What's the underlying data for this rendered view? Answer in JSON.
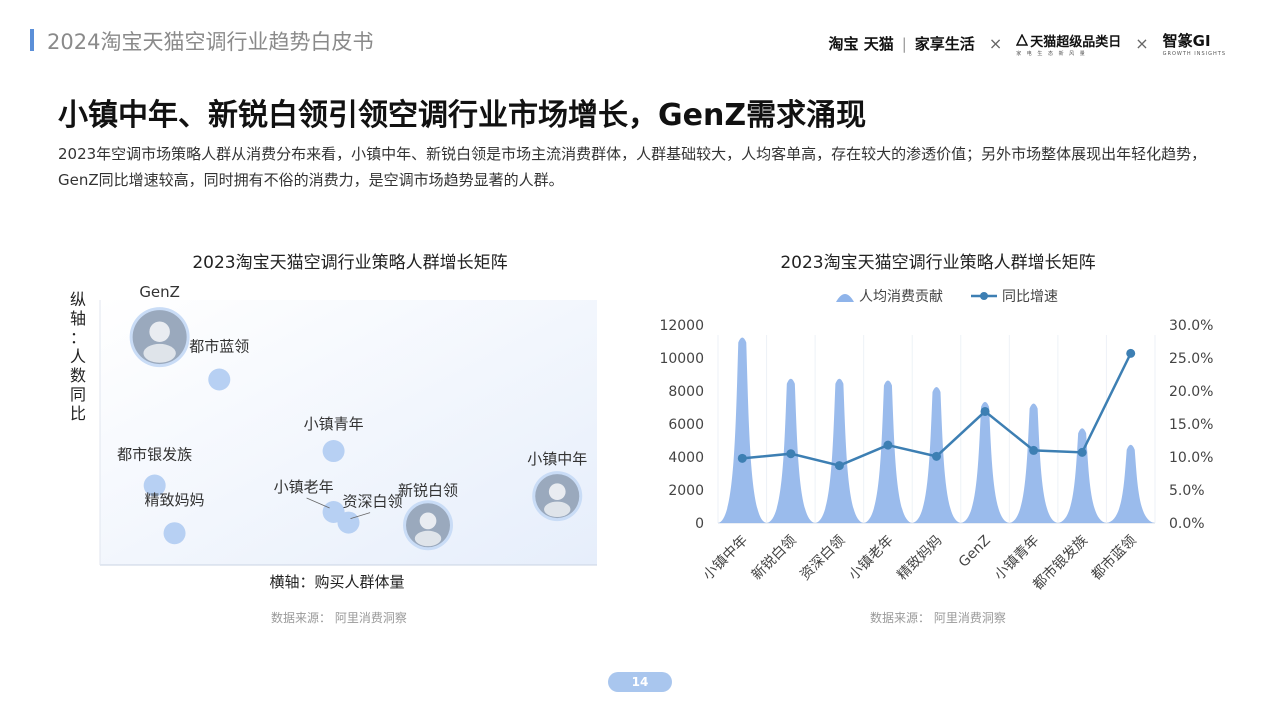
{
  "header": {
    "title": "2024淘宝天猫空调行业趋势白皮书"
  },
  "brands": {
    "taobao_tmall": "淘宝 天猫",
    "jiaxiang": "家享生活",
    "super_category": "天猫超级品类日",
    "super_category_sub": "家 电 生 态 新 风 量",
    "zhizuan": "智篆GI",
    "zhizuan_sub": "GROWTH INSIGHTS",
    "x_mark": "×"
  },
  "main_title": "小镇中年、新锐白领引领空调行业市场增长，GenZ需求涌现",
  "lead_text": "2023年空调市场策略人群从消费分布来看，小镇中年、新锐白领是市场主流消费群体，人群基础较大，人均客单高，存在较大的渗透价值；另外市场整体展现出年轻化趋势，GenZ同比增速较高，同时拥有不俗的消费力，是空调市场趋势显著的人群。",
  "left_chart_title": "2023淘宝天猫空调行业策略人群增长矩阵",
  "right_chart_title": "2023淘宝天猫空调行业策略人群增长矩阵",
  "source_left": "数据来源：  阿里消费洞察",
  "source_right": "数据来源：  阿里消费洞察",
  "page_number": "14",
  "chart_data": [
    {
      "type": "scatter",
      "title": "2023淘宝天猫空调行业策略人群增长矩阵",
      "xlabel": "横轴：购买人群体量",
      "ylabel": "纵轴：人数同比",
      "points": [
        {
          "label": "GenZ",
          "x": 0.12,
          "y": 0.86,
          "avatar": true
        },
        {
          "label": "都市蓝领",
          "x": 0.24,
          "y": 0.7,
          "avatar": false
        },
        {
          "label": "小镇青年",
          "x": 0.47,
          "y": 0.43,
          "avatar": false
        },
        {
          "label": "都市银发族",
          "x": 0.11,
          "y": 0.3,
          "avatar": false
        },
        {
          "label": "精致妈妈",
          "x": 0.15,
          "y": 0.12,
          "avatar": false
        },
        {
          "label": "小镇老年",
          "x": 0.47,
          "y": 0.2,
          "avatar": false
        },
        {
          "label": "资深白领",
          "x": 0.5,
          "y": 0.16,
          "avatar": false
        },
        {
          "label": "新锐白领",
          "x": 0.66,
          "y": 0.15,
          "avatar": true
        },
        {
          "label": "小镇中年",
          "x": 0.92,
          "y": 0.26,
          "avatar": true
        }
      ]
    },
    {
      "type": "area",
      "title": "2023淘宝天猫空调行业策略人群增长矩阵",
      "categories": [
        "小镇中年",
        "新锐白领",
        "资深白领",
        "小镇老年",
        "精致妈妈",
        "GenZ",
        "小镇青年",
        "都市银发族",
        "都市蓝领"
      ],
      "series": [
        {
          "name": "人均消费贡献",
          "type": "area",
          "axis": "left",
          "color": "#8fb4ea",
          "values": [
            11300,
            8800,
            8800,
            8700,
            8300,
            7400,
            7300,
            5800,
            4800
          ]
        },
        {
          "name": "同比增速",
          "type": "line",
          "axis": "right",
          "color": "#3d7fb3",
          "values": [
            9.8,
            10.5,
            8.7,
            11.8,
            10.1,
            16.9,
            11.0,
            10.7,
            25.7
          ]
        }
      ],
      "y_left": {
        "min": 0,
        "max": 12000,
        "ticks": [
          "0",
          "2000",
          "4000",
          "6000",
          "8000",
          "10000",
          "12000"
        ]
      },
      "y_right": {
        "min": 0,
        "max": 30,
        "ticks": [
          "0.0%",
          "5.0%",
          "10.0%",
          "15.0%",
          "20.0%",
          "25.0%",
          "30.0%"
        ]
      },
      "legend_position": "top"
    }
  ]
}
